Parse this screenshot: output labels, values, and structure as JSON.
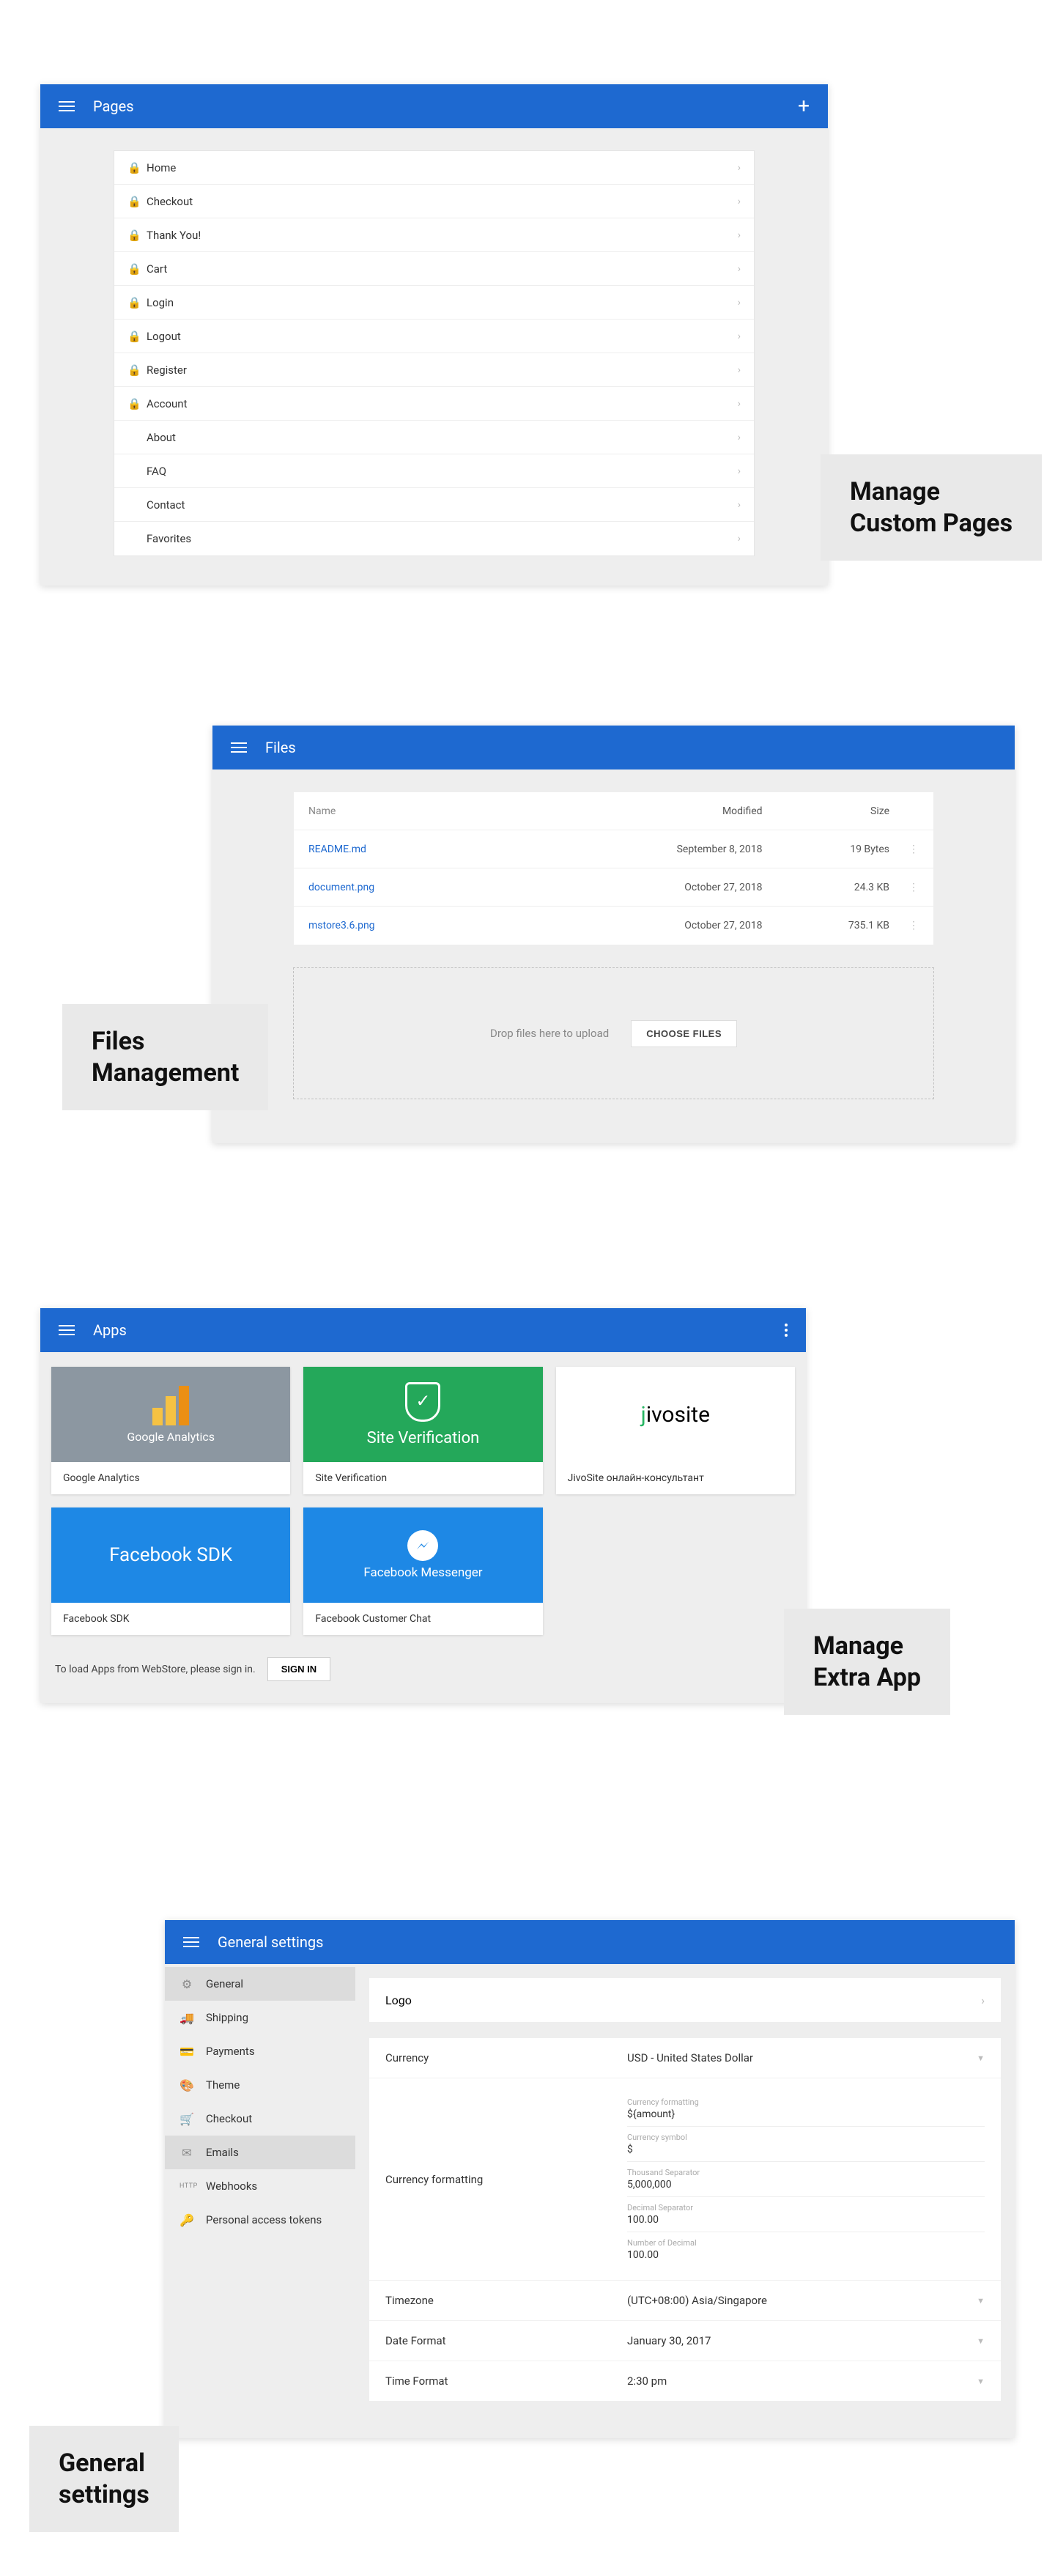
{
  "labels": {
    "pages": "Manage\nCustom Pages",
    "files": "Files\nManagement",
    "apps": "Manage\nExtra App",
    "settings": "General\nsettings"
  },
  "pages_panel": {
    "title": "Pages",
    "rows": [
      {
        "name": "Home",
        "locked": true
      },
      {
        "name": "Checkout",
        "locked": true
      },
      {
        "name": "Thank You!",
        "locked": true
      },
      {
        "name": "Cart",
        "locked": true
      },
      {
        "name": "Login",
        "locked": true
      },
      {
        "name": "Logout",
        "locked": true
      },
      {
        "name": "Register",
        "locked": true
      },
      {
        "name": "Account",
        "locked": true
      },
      {
        "name": "About",
        "locked": false
      },
      {
        "name": "FAQ",
        "locked": false
      },
      {
        "name": "Contact",
        "locked": false
      },
      {
        "name": "Favorites",
        "locked": false
      }
    ]
  },
  "files_panel": {
    "title": "Files",
    "headers": {
      "name": "Name",
      "modified": "Modified",
      "size": "Size"
    },
    "rows": [
      {
        "name": "README.md",
        "modified": "September 8, 2018",
        "size": "19 Bytes"
      },
      {
        "name": "document.png",
        "modified": "October 27, 2018",
        "size": "24.3 KB"
      },
      {
        "name": "mstore3.6.png",
        "modified": "October 27, 2018",
        "size": "735.1 KB"
      }
    ],
    "drop_text": "Drop files here to upload",
    "choose": "CHOOSE FILES"
  },
  "apps_panel": {
    "title": "Apps",
    "cards": [
      {
        "id": "ga",
        "head": "Google Analytics",
        "caption": "Google Analytics"
      },
      {
        "id": "sv",
        "head": "Site Verification",
        "caption": "Site Verification"
      },
      {
        "id": "jv",
        "head": "jivosite",
        "caption": "JivoSite онлайн-консультант"
      },
      {
        "id": "fb",
        "head": "Facebook SDK",
        "caption": "Facebook SDK"
      },
      {
        "id": "fm",
        "head": "Facebook Messenger",
        "caption": "Facebook Customer Chat"
      }
    ],
    "signin_text": "To load Apps from WebStore, please sign in.",
    "signin_btn": "SIGN IN"
  },
  "settings_panel": {
    "title": "General settings",
    "nav": [
      {
        "id": "general",
        "label": "General",
        "icon": "⚙"
      },
      {
        "id": "shipping",
        "label": "Shipping",
        "icon": "🚚"
      },
      {
        "id": "payments",
        "label": "Payments",
        "icon": "💳"
      },
      {
        "id": "theme",
        "label": "Theme",
        "icon": "🎨"
      },
      {
        "id": "checkout",
        "label": "Checkout",
        "icon": "🛒"
      },
      {
        "id": "emails",
        "label": "Emails",
        "icon": "✉"
      },
      {
        "id": "webhooks",
        "label": "Webhooks",
        "icon": "HTTP"
      },
      {
        "id": "tokens",
        "label": "Personal access tokens",
        "icon": "🔑"
      }
    ],
    "selected_nav": "general",
    "highlight_nav": "emails",
    "logo_label": "Logo",
    "currency": {
      "label": "Currency",
      "value": "USD - United States Dollar"
    },
    "currency_formatting": {
      "label": "Currency formatting",
      "items": [
        {
          "mini": "Currency formatting",
          "v": "${amount}"
        },
        {
          "mini": "Currency symbol",
          "v": "$"
        },
        {
          "mini": "Thousand Separator",
          "v": "5,000,000"
        },
        {
          "mini": "Decimal Separator",
          "v": "100.00"
        },
        {
          "mini": "Number of Decimal",
          "v": "100.00"
        }
      ]
    },
    "timezone": {
      "label": "Timezone",
      "value": "(UTC+08:00) Asia/Singapore"
    },
    "dateformat": {
      "label": "Date Format",
      "value": "January 30, 2017"
    },
    "timeformat": {
      "label": "Time Format",
      "value": "2:30 pm"
    }
  }
}
